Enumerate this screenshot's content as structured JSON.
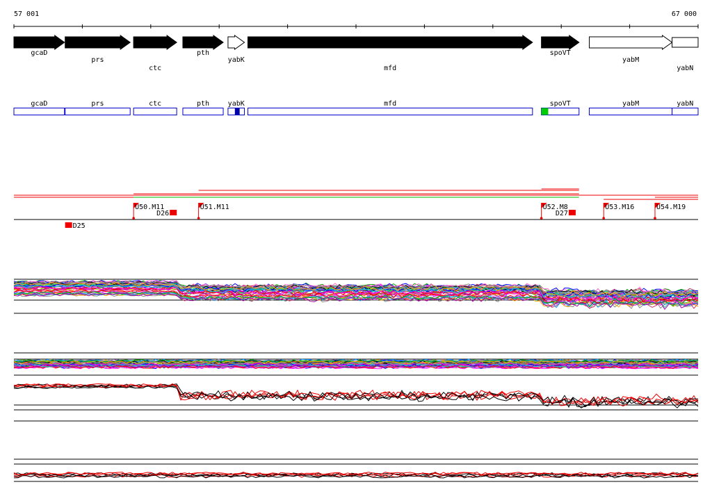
{
  "coords": {
    "start_label": "57 001",
    "end_label": "67 000"
  },
  "genes": [
    {
      "name": "gcaD",
      "strand": "+",
      "start": 57001,
      "end": 57740,
      "filled": true
    },
    {
      "name": "prs",
      "strand": "+",
      "start": 57750,
      "end": 58700,
      "filled": true
    },
    {
      "name": "ctc",
      "strand": "+",
      "start": 58750,
      "end": 59380,
      "filled": true
    },
    {
      "name": "pth",
      "strand": "+",
      "start": 59470,
      "end": 60060,
      "filled": true
    },
    {
      "name": "yabK",
      "strand": "+",
      "start": 60130,
      "end": 60370,
      "filled": false
    },
    {
      "name": "mfd",
      "strand": "+",
      "start": 60420,
      "end": 64580,
      "filled": true
    },
    {
      "name": "spoVT",
      "strand": "+",
      "start": 64710,
      "end": 65260,
      "filled": true
    },
    {
      "name": "yabM",
      "strand": "+",
      "start": 65410,
      "end": 66620,
      "filled": false
    },
    {
      "name": "yabN",
      "strand": "+",
      "start": 66620,
      "end": 67000,
      "filled": false
    }
  ],
  "annotation_marks": [
    {
      "gene": "yabK",
      "start": 60230,
      "end": 60300,
      "color": "#0000aa"
    },
    {
      "gene": "spoVT",
      "start": 64710,
      "end": 64810,
      "color": "#00cc00"
    }
  ],
  "colors": {
    "gene_fill": "#000000",
    "gene_box": "#0000cc",
    "upstream": "#ee0000",
    "downstream": "#00bb00",
    "axis": "#000000"
  },
  "upstream_marks": [
    {
      "label": "U50.M11",
      "pos": 58750
    },
    {
      "label": "U51.M11",
      "pos": 59700
    },
    {
      "label": "U52.M8",
      "pos": 64710
    },
    {
      "label": "U53.M16",
      "pos": 65620
    },
    {
      "label": "U54.M19",
      "pos": 66370
    }
  ],
  "downstream_marks": [
    {
      "label": "D25",
      "pos": 57800
    },
    {
      "label": "D26",
      "pos": 59330
    },
    {
      "label": "D27",
      "pos": 65160
    }
  ]
}
